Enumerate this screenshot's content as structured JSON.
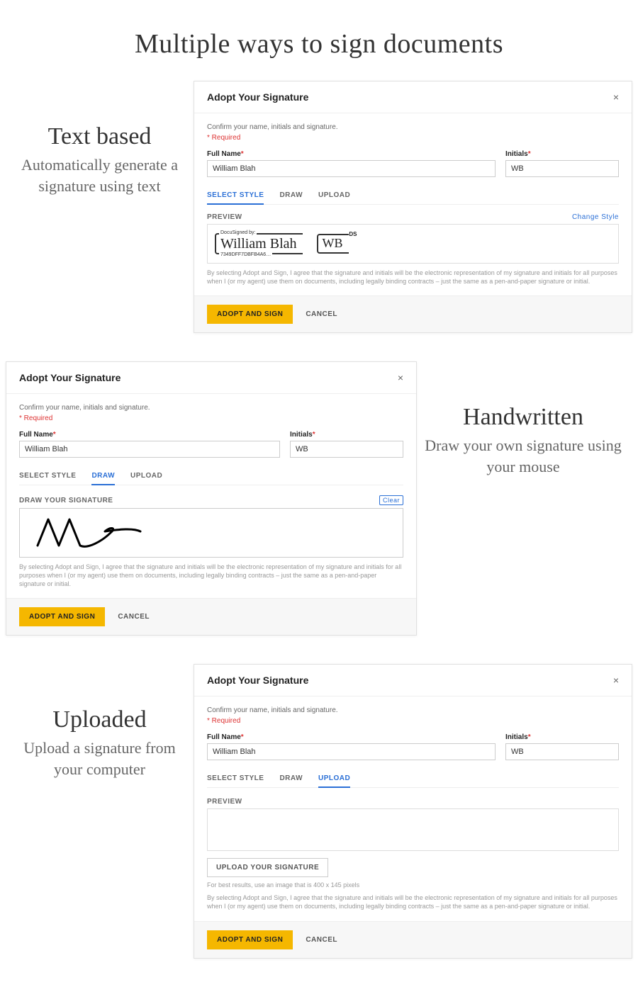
{
  "pageTitle": "Multiple ways to sign documents",
  "sections": {
    "text": {
      "title": "Text based",
      "subtitle": "Automatically generate a signature using text"
    },
    "hand": {
      "title": "Handwritten",
      "subtitle": "Draw your own signature using your mouse"
    },
    "upload": {
      "title": "Uploaded",
      "subtitle": "Upload a signature from your computer"
    }
  },
  "dialog": {
    "title": "Adopt Your Signature",
    "confirm": "Confirm your name, initials and signature.",
    "required": "Required",
    "fullNameLabel": "Full Name",
    "initialsLabel": "Initials",
    "fullNameValue": "William Blah",
    "initialsValue": "WB",
    "tabs": {
      "select": "SELECT STYLE",
      "draw": "DRAW",
      "upload": "UPLOAD"
    },
    "previewLabel": "PREVIEW",
    "changeStyle": "Change Style",
    "docusignedBy": "DocuSigned by:",
    "sigHash": "7349DFF7DBFB4A6…",
    "sigScript": "William Blah",
    "sigInitials": "WB",
    "dsLabel": "DS",
    "drawLabel": "DRAW YOUR SIGNATURE",
    "clear": "Clear",
    "agreement": "By selecting Adopt and Sign, I agree that the signature and initials will be the electronic representation of my signature and initials for all purposes when I (or my agent) use them on documents, including legally binding contracts – just the same as a pen-and-paper signature or initial.",
    "adoptBtn": "ADOPT AND SIGN",
    "cancelBtn": "CANCEL",
    "uploadBtn": "UPLOAD YOUR SIGNATURE",
    "uploadHint": "For best results, use an image that is 400 x 145 pixels"
  }
}
